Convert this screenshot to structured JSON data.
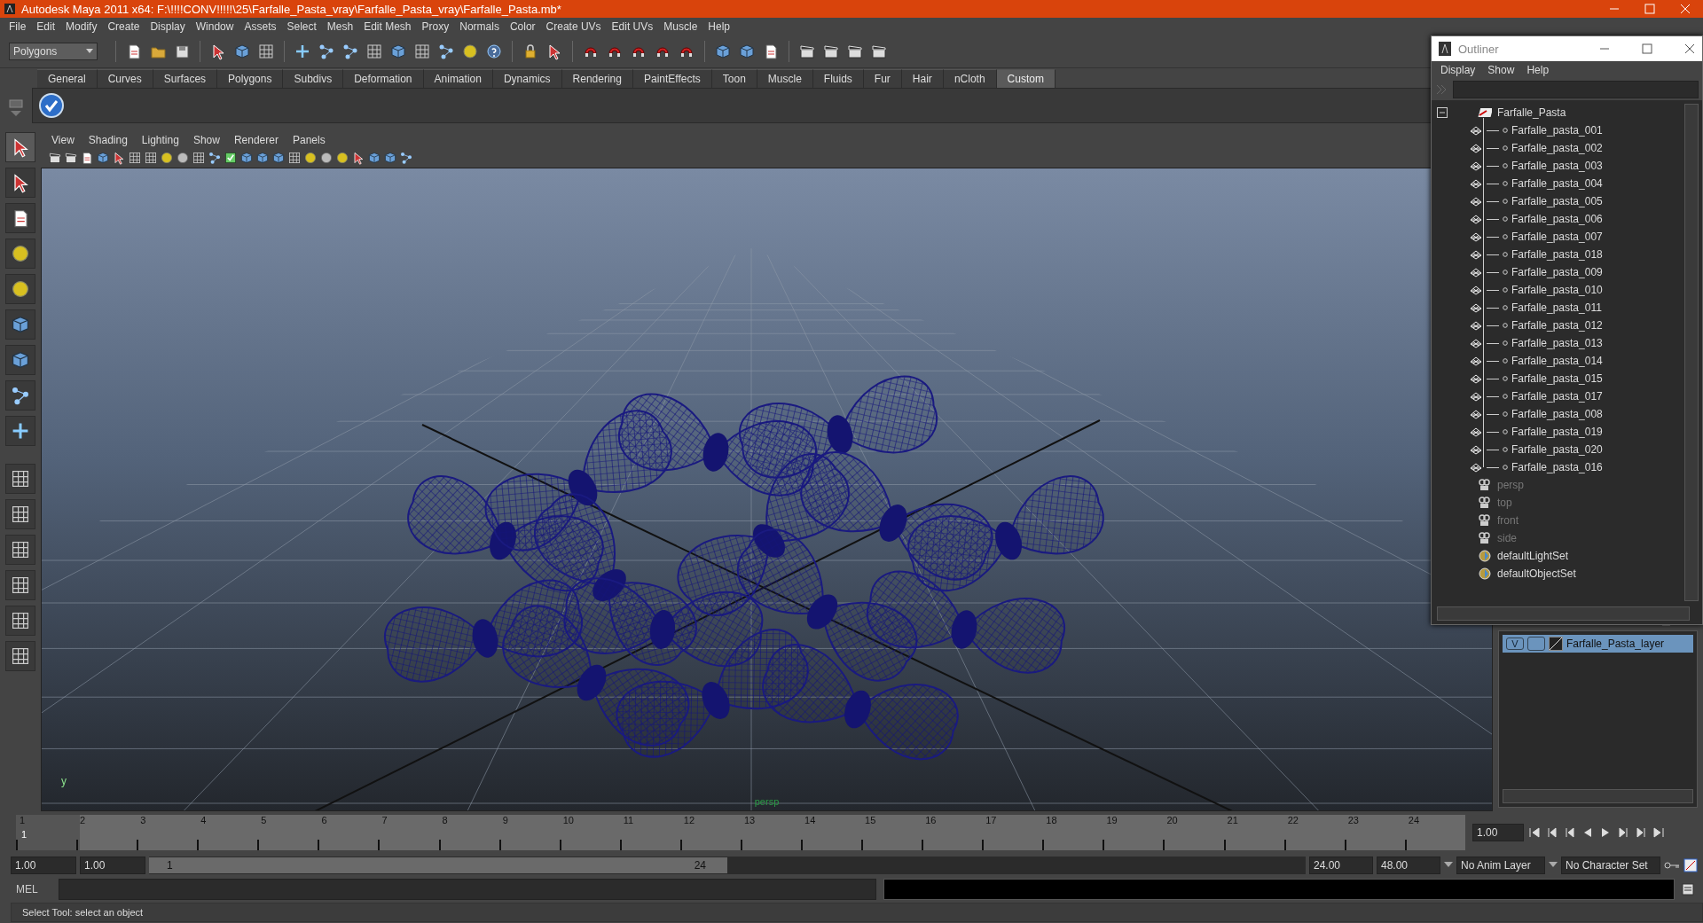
{
  "window": {
    "title": "Autodesk Maya 2011 x64: F:\\!!!!CONV!!!!!\\25\\Farfalle_Pasta_vray\\Farfalle_Pasta_vray\\Farfalle_Pasta.mb*"
  },
  "menu_bar": [
    "File",
    "Edit",
    "Modify",
    "Create",
    "Display",
    "Window",
    "Assets",
    "Select",
    "Mesh",
    "Edit Mesh",
    "Proxy",
    "Normals",
    "Color",
    "Create UVs",
    "Edit UVs",
    "Muscle",
    "Help"
  ],
  "toolbar": {
    "mode": "Polygons"
  },
  "shelf_tabs": [
    {
      "label": "General",
      "selected": false
    },
    {
      "label": "Curves",
      "selected": false
    },
    {
      "label": "Surfaces",
      "selected": false
    },
    {
      "label": "Polygons",
      "selected": false
    },
    {
      "label": "Subdivs",
      "selected": false
    },
    {
      "label": "Deformation",
      "selected": false
    },
    {
      "label": "Animation",
      "selected": false
    },
    {
      "label": "Dynamics",
      "selected": false
    },
    {
      "label": "Rendering",
      "selected": false
    },
    {
      "label": "PaintEffects",
      "selected": false
    },
    {
      "label": "Toon",
      "selected": false
    },
    {
      "label": "Muscle",
      "selected": false
    },
    {
      "label": "Fluids",
      "selected": false
    },
    {
      "label": "Fur",
      "selected": false
    },
    {
      "label": "Hair",
      "selected": false
    },
    {
      "label": "nCloth",
      "selected": false
    },
    {
      "label": "Custom",
      "selected": true
    }
  ],
  "viewport": {
    "menu": [
      "View",
      "Shading",
      "Lighting",
      "Show",
      "Renderer",
      "Panels"
    ],
    "camera_label": "persp",
    "axis_label": "y"
  },
  "outliner": {
    "title": "Outliner",
    "menu": [
      "Display",
      "Show",
      "Help"
    ],
    "items": [
      {
        "label": "Farfalle_Pasta",
        "kind": "group",
        "hidden": false,
        "expanded": true,
        "children": [
          {
            "label": "Farfalle_pasta_001",
            "kind": "mesh"
          },
          {
            "label": "Farfalle_pasta_002",
            "kind": "mesh"
          },
          {
            "label": "Farfalle_pasta_003",
            "kind": "mesh"
          },
          {
            "label": "Farfalle_pasta_004",
            "kind": "mesh"
          },
          {
            "label": "Farfalle_pasta_005",
            "kind": "mesh"
          },
          {
            "label": "Farfalle_pasta_006",
            "kind": "mesh"
          },
          {
            "label": "Farfalle_pasta_007",
            "kind": "mesh"
          },
          {
            "label": "Farfalle_pasta_018",
            "kind": "mesh"
          },
          {
            "label": "Farfalle_pasta_009",
            "kind": "mesh"
          },
          {
            "label": "Farfalle_pasta_010",
            "kind": "mesh"
          },
          {
            "label": "Farfalle_pasta_011",
            "kind": "mesh"
          },
          {
            "label": "Farfalle_pasta_012",
            "kind": "mesh"
          },
          {
            "label": "Farfalle_pasta_013",
            "kind": "mesh"
          },
          {
            "label": "Farfalle_pasta_014",
            "kind": "mesh"
          },
          {
            "label": "Farfalle_pasta_015",
            "kind": "mesh"
          },
          {
            "label": "Farfalle_pasta_017",
            "kind": "mesh"
          },
          {
            "label": "Farfalle_pasta_008",
            "kind": "mesh"
          },
          {
            "label": "Farfalle_pasta_019",
            "kind": "mesh"
          },
          {
            "label": "Farfalle_pasta_020",
            "kind": "mesh"
          },
          {
            "label": "Farfalle_pasta_016",
            "kind": "mesh"
          }
        ]
      },
      {
        "label": "persp",
        "kind": "camera",
        "hidden": true
      },
      {
        "label": "top",
        "kind": "camera",
        "hidden": true
      },
      {
        "label": "front",
        "kind": "camera",
        "hidden": true
      },
      {
        "label": "side",
        "kind": "camera",
        "hidden": true
      },
      {
        "label": "defaultLightSet",
        "kind": "set",
        "hidden": false
      },
      {
        "label": "defaultObjectSet",
        "kind": "set",
        "hidden": false
      }
    ]
  },
  "layers": [
    {
      "visibility": "V",
      "name": "Farfalle_Pasta_layer",
      "selected": true
    }
  ],
  "timeline": {
    "ticks": [
      "1",
      "2",
      "3",
      "4",
      "5",
      "6",
      "7",
      "8",
      "9",
      "10",
      "11",
      "12",
      "13",
      "14",
      "15",
      "16",
      "17",
      "18",
      "19",
      "20",
      "21",
      "22",
      "23",
      "24"
    ],
    "current_frame": "1",
    "current_time": "1.00",
    "level": 0
  },
  "range": {
    "start": "1.00",
    "inner_start": "1.00",
    "slider_start": "1",
    "slider_end": "24",
    "level": 0.5,
    "inner_end": "24.00",
    "end": "48.00",
    "anim_layer": "No Anim Layer",
    "character_set": "No Character Set"
  },
  "command_line": {
    "label": "MEL"
  },
  "status_bar": {
    "text": "Select Tool: select an object"
  }
}
